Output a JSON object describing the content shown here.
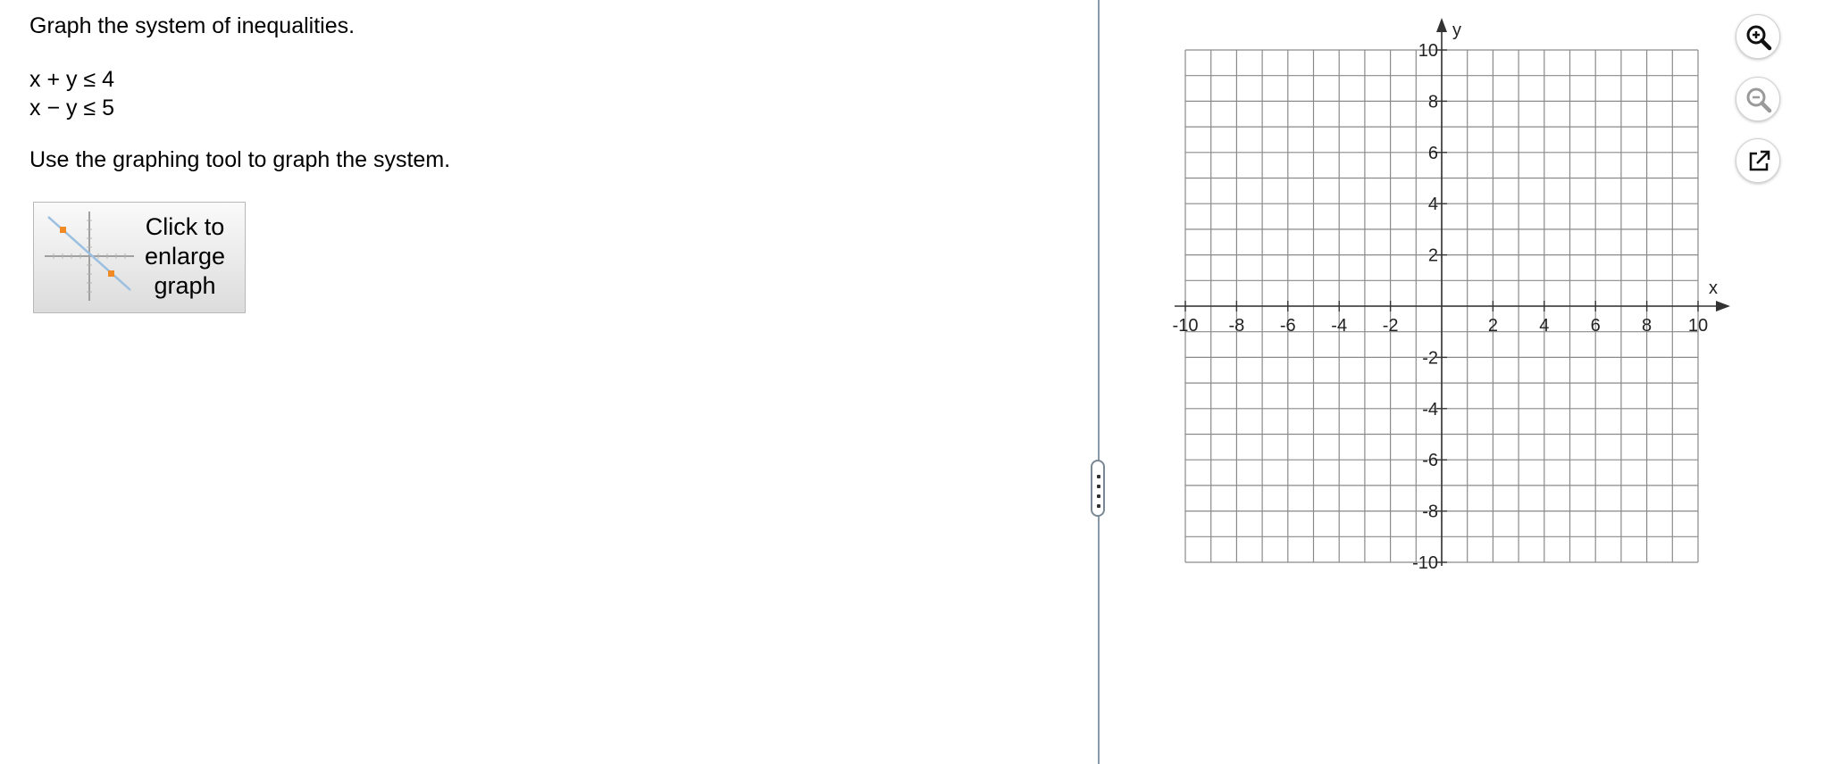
{
  "question": {
    "prompt": "Graph the system of inequalities.",
    "inequality_1": "x + y ≤ 4",
    "inequality_2": "x − y ≤ 5",
    "instruction": "Use the graphing tool to graph the system."
  },
  "enlarge_button": {
    "label": "Click to\nenlarge\ngraph"
  },
  "graph_tools": {
    "zoom_in_icon": "zoom-in-icon",
    "zoom_out_icon": "zoom-out-icon",
    "popout_icon": "popout-icon"
  },
  "chart_data": {
    "type": "scatter",
    "xlabel": "x",
    "ylabel": "y",
    "xlim": [
      -10,
      10
    ],
    "ylim": [
      -10,
      10
    ],
    "grid": true,
    "grid_step": 1,
    "x_ticks": [
      -10,
      -8,
      -6,
      -4,
      -2,
      2,
      4,
      6,
      8,
      10
    ],
    "y_ticks": [
      10,
      8,
      6,
      4,
      2,
      -2,
      -4,
      -6,
      -8,
      -10
    ],
    "x_tick_labels": [
      "-10",
      "-8",
      "-6",
      "-4",
      "-2",
      "2",
      "4",
      "6",
      "8",
      "10"
    ],
    "y_tick_labels": [
      "10",
      "8",
      "6",
      "4",
      "2",
      "-2",
      "-4",
      "-6",
      "-8",
      "-10"
    ],
    "series": []
  },
  "colors": {
    "grid": "#8a8a8a",
    "axis": "#333333",
    "divider": "#8899aa",
    "thumb_line": "#9bbfe0",
    "thumb_point": "#f08a24"
  }
}
